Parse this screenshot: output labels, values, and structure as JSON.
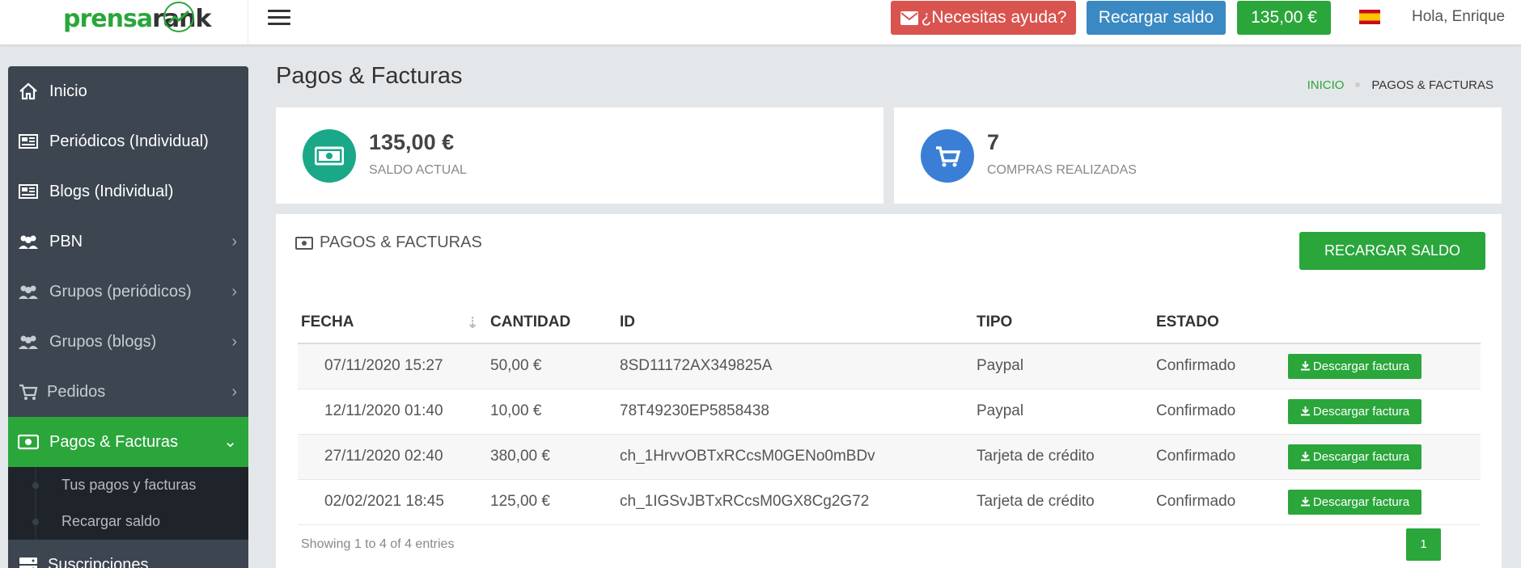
{
  "brand": {
    "logo_part1": "prensa",
    "logo_part2": "rank"
  },
  "topbar": {
    "help_label": "¿Necesitas ayuda?",
    "recharge_label": "Recargar saldo",
    "balance_label": "135,00 €",
    "greeting": "Hola, Enrique",
    "flag_icon": "spain-flag-icon"
  },
  "sidebar": {
    "items": [
      {
        "label": "Inicio",
        "icon": "home-icon"
      },
      {
        "label": "Periódicos (Individual)",
        "icon": "newspaper-icon"
      },
      {
        "label": "Blogs (Individual)",
        "icon": "newspaper-icon"
      },
      {
        "label": "PBN",
        "icon": "users-icon"
      },
      {
        "label": "Grupos (periódicos)",
        "icon": "users-icon"
      },
      {
        "label": "Grupos (blogs)",
        "icon": "users-icon"
      },
      {
        "label": "Pedidos",
        "icon": "cart-icon"
      },
      {
        "label": "Pagos & Facturas",
        "icon": "money-icon"
      },
      {
        "label": "Suscripciones",
        "icon": "server-icon"
      }
    ],
    "submenu": [
      "Tus pagos y facturas",
      "Recargar saldo"
    ]
  },
  "page": {
    "title": "Pagos & Facturas",
    "breadcrumb_home": "INICIO",
    "breadcrumb_current": "PAGOS & FACTURAS"
  },
  "stats": {
    "balance_value": "135,00 €",
    "balance_label": "SALDO ACTUAL",
    "purchases_value": "7",
    "purchases_label": "COMPRAS REALIZADAS"
  },
  "panel": {
    "title": "PAGOS & FACTURAS",
    "recharge_label": "RECARGAR SALDO",
    "columns": [
      "FECHA",
      "CANTIDAD",
      "ID",
      "TIPO",
      "ESTADO"
    ],
    "download_label": "Descargar factura",
    "rows": [
      {
        "fecha": "07/11/2020 15:27",
        "cantidad": "50,00 €",
        "id": "8SD11172AX349825A",
        "tipo": "Paypal",
        "estado": "Confirmado"
      },
      {
        "fecha": "12/11/2020 01:40",
        "cantidad": "10,00 €",
        "id": "78T49230EP5858438",
        "tipo": "Paypal",
        "estado": "Confirmado"
      },
      {
        "fecha": "27/11/2020 02:40",
        "cantidad": "380,00 €",
        "id": "ch_1HrvvOBTxRCcsM0GENo0mBDv",
        "tipo": "Tarjeta de crédito",
        "estado": "Confirmado"
      },
      {
        "fecha": "02/02/2021 18:45",
        "cantidad": "125,00 €",
        "id": "ch_1IGSvJBTxRCcsM0GX8Cg2G72",
        "tipo": "Tarjeta de crédito",
        "estado": "Confirmado"
      }
    ],
    "info": "Showing 1 to 4 of 4 entries",
    "page_number": "1"
  },
  "colors": {
    "primary": "#2aa63b",
    "danger": "#d9534f",
    "info": "#3a89c2",
    "sidebar": "#3c4550",
    "teal": "#1aa888",
    "blue": "#3a7fd5"
  }
}
